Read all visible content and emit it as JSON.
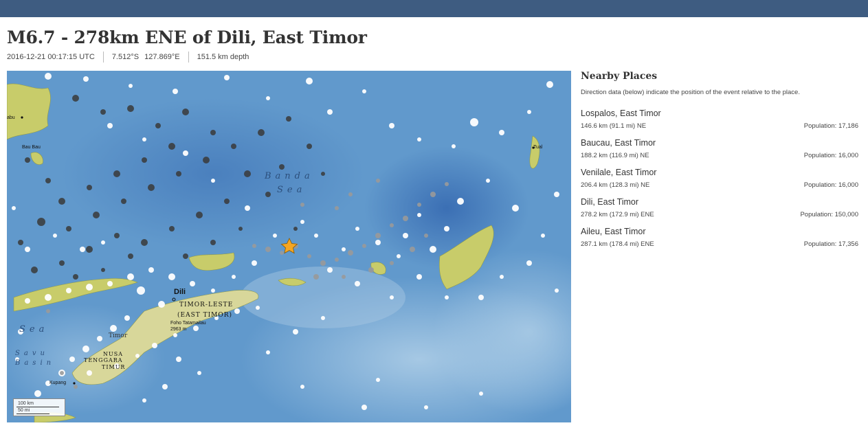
{
  "header": {
    "title": "M6.7 - 278km ENE of Dili, East Timor"
  },
  "event_meta": {
    "time": "2016-12-21 00:17:15 UTC",
    "latitude": "7.512°S",
    "longitude": "127.869°E",
    "depth": "151.5 km depth"
  },
  "map": {
    "labels": {
      "baubau": "Bau Bau",
      "abu": "abu",
      "tual": "Tual",
      "banda": "Banda",
      "sea": "Sea",
      "dili": "Dili",
      "timor_leste": "TIMOR-LESTE",
      "east_timor": "(EAST TIMOR)",
      "peak": "Foho Tatamailau",
      "peak_height": "2963 m",
      "timor": "Timor",
      "nusa": "NUSA",
      "tenggara": "TENGGARA",
      "timur": "TIMUR",
      "savu": "Savu",
      "basin": "Basin",
      "sea_left": "Sea",
      "kupang": "Kupang"
    },
    "scale": {
      "km": "100 km",
      "mi": "50 mi"
    },
    "colors": {
      "ocean": "#5f97cc",
      "land": "#c8cc6a",
      "epicenter": "#f5a623"
    }
  },
  "nearby": {
    "title": "Nearby Places",
    "description": "Direction data (below) indicate the position of the event relative to the place.",
    "places": [
      {
        "name": "Lospalos, East Timor",
        "distance": "146.6 km (91.1 mi) NE",
        "population": "Population: 17,186"
      },
      {
        "name": "Baucau, East Timor",
        "distance": "188.2 km (116.9 mi) NE",
        "population": "Population: 16,000"
      },
      {
        "name": "Venilale, East Timor",
        "distance": "206.4 km (128.3 mi) NE",
        "population": "Population: 16,000"
      },
      {
        "name": "Dili, East Timor",
        "distance": "278.2 km (172.9 mi) ENE",
        "population": "Population: 150,000"
      },
      {
        "name": "Aileu, East Timor",
        "distance": "287.1 km (178.4 mi) ENE",
        "population": "Population: 17,356"
      }
    ]
  }
}
